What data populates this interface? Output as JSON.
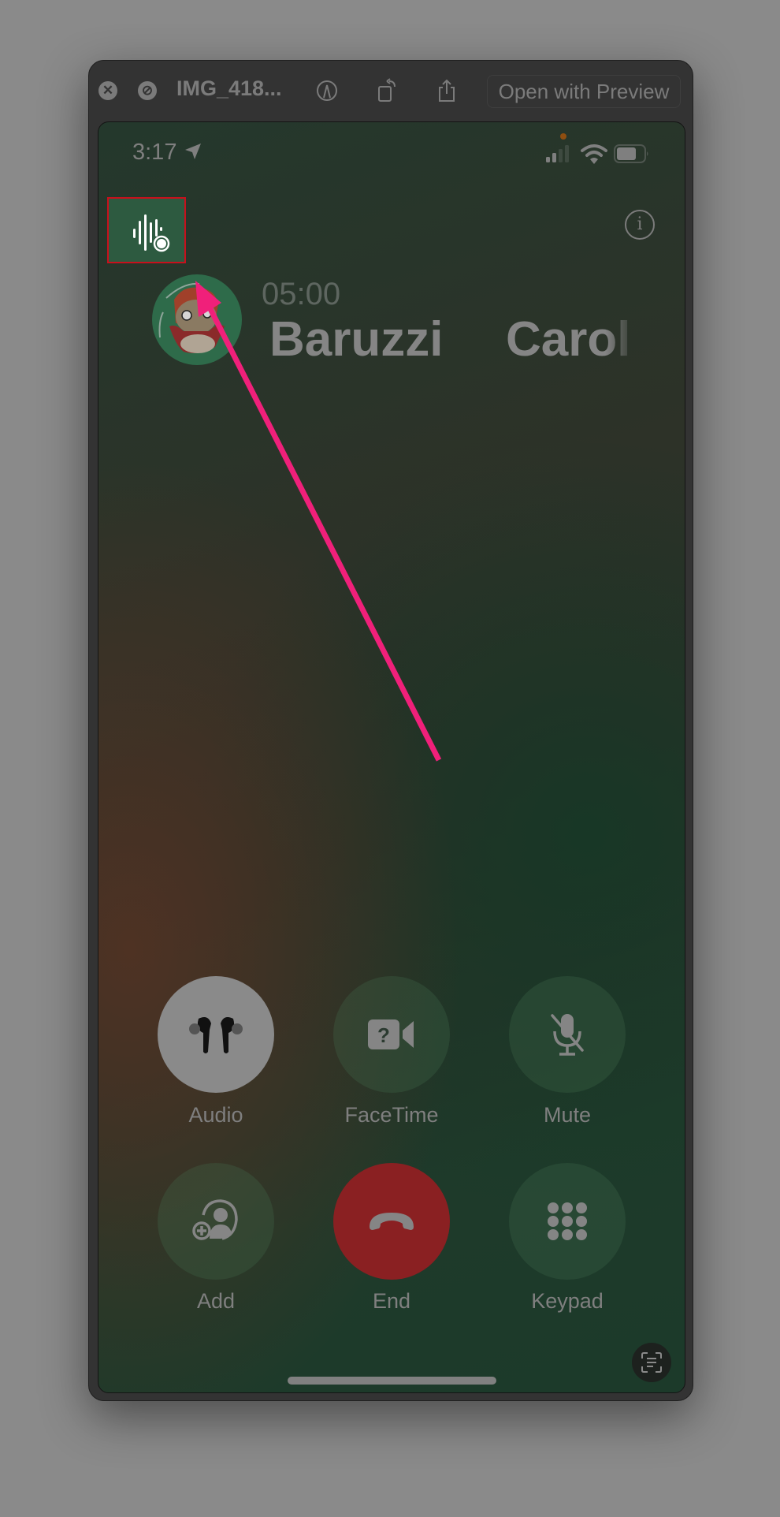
{
  "window": {
    "title": "IMG_418...",
    "open_with_label": "Open with Preview",
    "icons": [
      "close-icon",
      "hide-icon",
      "markup-icon",
      "rotate-icon",
      "share-icon"
    ]
  },
  "status_bar": {
    "time": "3:17",
    "icons": [
      "location-arrow-icon",
      "cellular-signal-icon",
      "wifi-icon",
      "battery-icon"
    ]
  },
  "call": {
    "duration": "05:00",
    "name_first": "Baruzzi",
    "name_last": "Carol",
    "recording_icon": "waveform-record-icon",
    "info_icon_glyph": "i"
  },
  "buttons": [
    {
      "id": "audio",
      "label": "Audio",
      "icon": "airpods-icon"
    },
    {
      "id": "facetime",
      "label": "FaceTime",
      "icon": "video-question-icon"
    },
    {
      "id": "mute",
      "label": "Mute",
      "icon": "mic-slash-icon"
    },
    {
      "id": "add",
      "label": "Add",
      "icon": "person-add-icon"
    },
    {
      "id": "end",
      "label": "End",
      "icon": "phone-down-icon"
    },
    {
      "id": "keypad",
      "label": "Keypad",
      "icon": "keypad-icon"
    }
  ],
  "colors": {
    "annotation_arrow": "#f0207a",
    "highlight_border": "#c8101c",
    "end_call": "#8a2022"
  }
}
